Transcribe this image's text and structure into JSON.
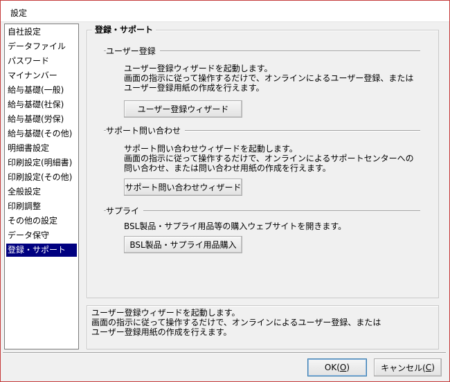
{
  "window": {
    "title": "設定"
  },
  "nav": {
    "items": [
      "自社設定",
      "データファイル",
      "パスワード",
      "マイナンバー",
      "給与基礎(一般)",
      "給与基礎(社保)",
      "給与基礎(労保)",
      "給与基礎(その他)",
      "明細書設定",
      "印刷設定(明細書)",
      "印刷設定(その他)",
      "全般設定",
      "印刷調整",
      "その他の設定",
      "データ保守",
      "登録・サポート"
    ],
    "selected_index": 15
  },
  "panel": {
    "title": "登録・サポート",
    "user_reg": {
      "label": "ユーザー登録",
      "desc": [
        "ユーザー登録ウィザードを起動します。",
        "画面の指示に従って操作するだけで、オンラインによるユーザー登録、または",
        "ユーザー登録用紙の作成を行えます。"
      ],
      "button": "ユーザー登録ウィザード"
    },
    "support": {
      "label": "サポート問い合わせ",
      "desc": [
        "サポート問い合わせウィザードを起動します。",
        "画面の指示に従って操作するだけで、オンラインによるサポートセンターへの",
        "問い合わせ、または問い合わせ用紙の作成を行えます。"
      ],
      "button": "サポート問い合わせウィザード"
    },
    "supply": {
      "label": "サプライ",
      "desc": [
        "BSL製品・サプライ用品等の購入ウェブサイトを開きます。"
      ],
      "button": "BSL製品・サプライ用品購入"
    }
  },
  "help": {
    "lines": [
      "ユーザー登録ウィザードを起動します。",
      "画面の指示に従って操作するだけで、オンラインによるユーザー登録、または",
      "ユーザー登録用紙の作成を行えます。"
    ]
  },
  "footer": {
    "ok_label": "OK(",
    "ok_key": "O",
    "ok_suffix": ")",
    "cancel_label": "キャンセル(",
    "cancel_key": "C",
    "cancel_suffix": ")"
  }
}
